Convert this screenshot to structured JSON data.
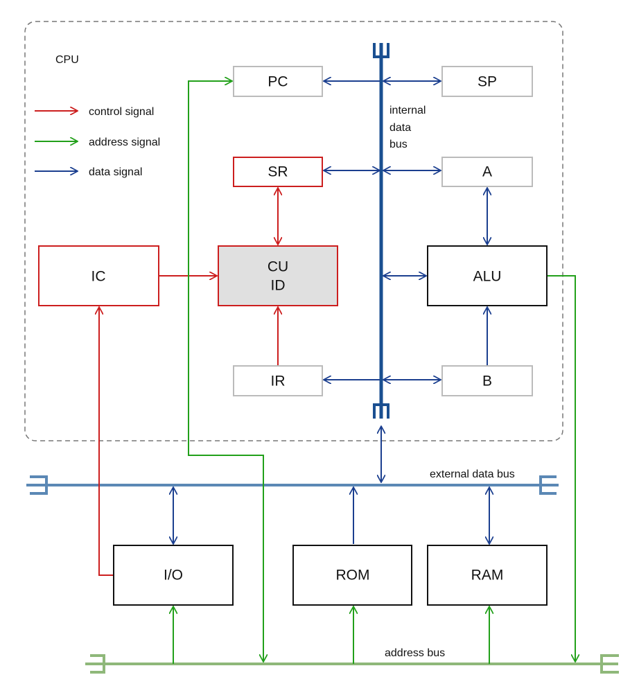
{
  "cpu_label": "CPU",
  "legend": [
    {
      "label": "control signal",
      "color": "#cc1e1e"
    },
    {
      "label": "address signal",
      "color": "#22a01a"
    },
    {
      "label": "data signal",
      "color": "#1b3f8f"
    }
  ],
  "blocks": {
    "pc": "PC",
    "sp": "SP",
    "sr": "SR",
    "a": "A",
    "ic": "IC",
    "cu": "CU",
    "id": "ID",
    "alu": "ALU",
    "ir": "IR",
    "b": "B",
    "io": "I/O",
    "rom": "ROM",
    "ram": "RAM"
  },
  "buses": {
    "internal": [
      "internal",
      "data",
      "bus"
    ],
    "external": "external data bus",
    "address": "address bus"
  },
  "colors": {
    "control": "#cc1e1e",
    "address": "#22a01a",
    "data": "#1b3f8f",
    "internal_bus": "#1a4f91",
    "external_bus": "#5b88b5",
    "address_bus": "#8fb87a",
    "cu_fill": "#e0e0e0"
  }
}
